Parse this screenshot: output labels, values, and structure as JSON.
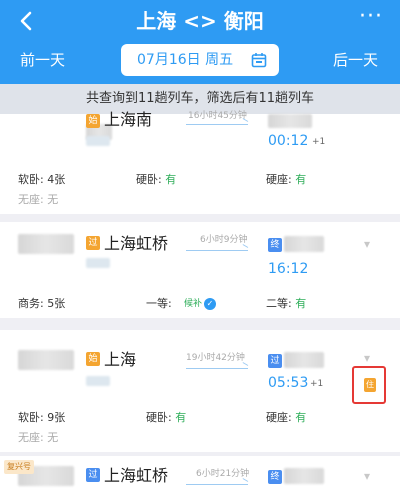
{
  "header": {
    "back_icon": "chevron-left-icon",
    "title": "上海 <> 衡阳",
    "more_label": "···",
    "prev_day": "前一天",
    "next_day": "后一天",
    "date": "07月16日 周五",
    "calendar_icon": "calendar-icon"
  },
  "summary": "共查询到11趟列车，筛选后有11趟列车",
  "trains": [
    {
      "from_station": "上海南",
      "duration": "16小时45分钟",
      "arrival_time": "00:12",
      "day_offset": "+1",
      "seats": [
        {
          "label": "软卧:",
          "value": "4张"
        },
        {
          "label": "硬卧:",
          "value": "有"
        },
        {
          "label": "硬座:",
          "value": "有"
        },
        {
          "label": "无座:",
          "value": "无"
        }
      ]
    },
    {
      "from_station": "上海虹桥",
      "duration": "6小时9分钟",
      "arrival_time": "16:12",
      "day_offset": "",
      "seats": [
        {
          "label": "商务:",
          "value": "5张"
        },
        {
          "label": "一等:",
          "value": "候补"
        },
        {
          "label": "二等:",
          "value": "有"
        }
      ]
    },
    {
      "from_station": "上海",
      "duration": "19小时42分钟",
      "arrival_time": "05:53",
      "day_offset": "+1",
      "seats": [
        {
          "label": "软卧:",
          "value": "9张"
        },
        {
          "label": "硬卧:",
          "value": "有"
        },
        {
          "label": "硬座:",
          "value": "有"
        },
        {
          "label": "无座:",
          "value": "无"
        }
      ]
    },
    {
      "tag": "复兴号",
      "from_station": "上海虹桥",
      "duration": "6小时21分钟",
      "arrival_time": "",
      "day_offset": ""
    }
  ],
  "colors": {
    "brand": "#2e9bf3",
    "available": "#2fae5a",
    "highlight_box": "#e53935"
  }
}
